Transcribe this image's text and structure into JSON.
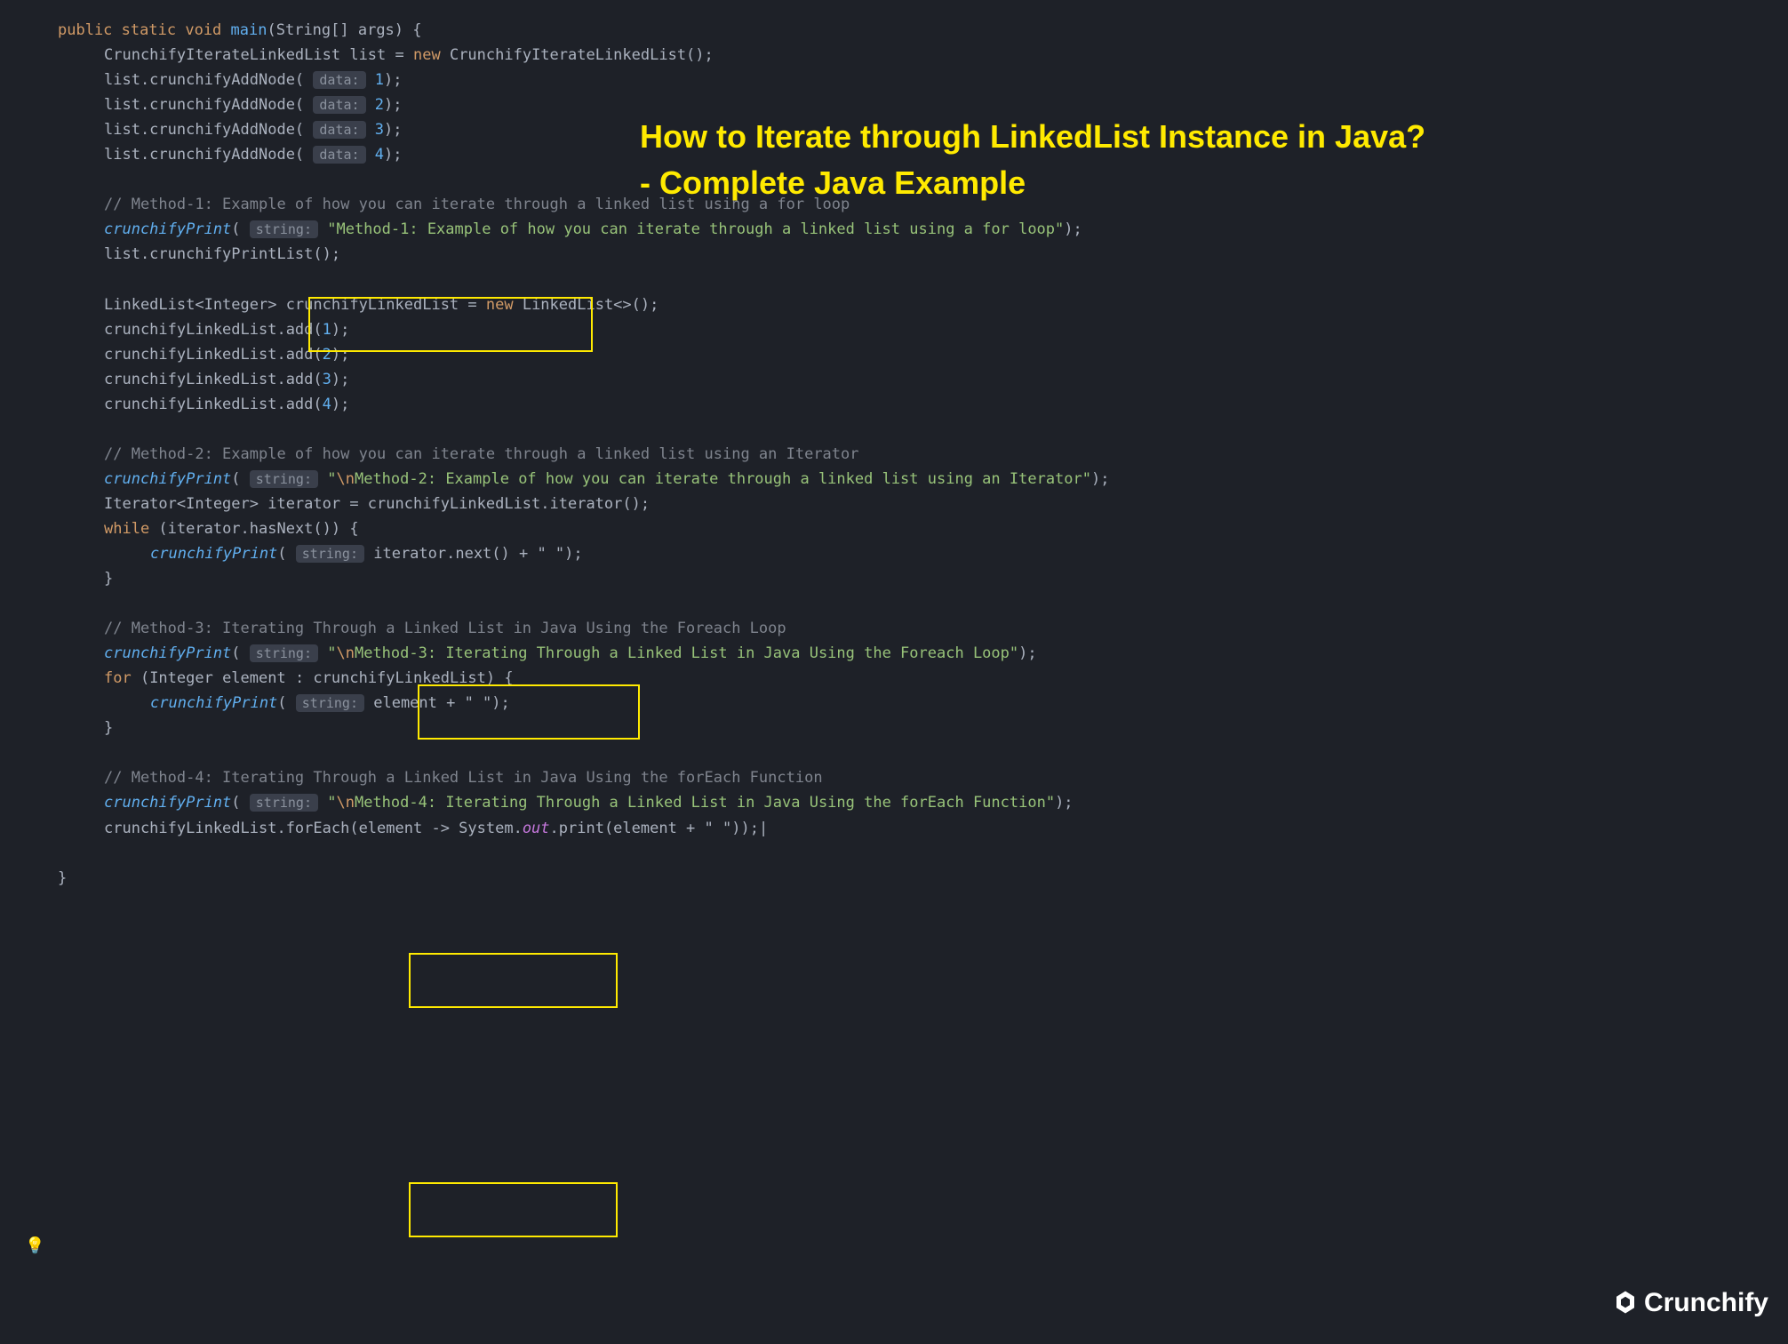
{
  "title_line1": "How to Iterate through LinkedList Instance in Java?",
  "title_line2": "- Complete Java Example",
  "logo_text": "Crunchify",
  "bulb": "💡",
  "kw": {
    "public": "public",
    "static": "static",
    "void": "void",
    "new": "new",
    "while": "while",
    "for": "for"
  },
  "sig": {
    "main": "main",
    "params": "(String[] args) {"
  },
  "hints": {
    "data": "data:",
    "string": "string:"
  },
  "lines": {
    "l1_a": "CrunchifyIterateLinkedList list = ",
    "l1_b": " CrunchifyIterateLinkedList();",
    "add_prefix": "list.crunchifyAddNode( ",
    "add_suffix": ");",
    "n1": " 1",
    "n2": " 2",
    "n3": " 3",
    "n4": " 4",
    "cmt1": "// Method-1: Example of how you can iterate through a linked list using a for loop",
    "cp": "crunchifyPrint",
    "cp_open": "( ",
    "str1": " \"Method-1: Example of how you can iterate through a linked list using a for loop\"",
    "close_p": ");",
    "printlist": "list.crunchifyPrintList();",
    "ll_decl_a": "LinkedList<Integer> crunchifyLinkedList = ",
    "ll_decl_b": " LinkedList<>();",
    "lladd_prefix": "crunchifyLinkedList.add(",
    "lladd_num1": "1",
    "lladd_num2": "2",
    "lladd_num3": "3",
    "lladd_num4": "4",
    "lladd_suffix": ");",
    "cmt2": "// Method-2: Example of how you can iterate through a linked list using an Iterator",
    "str2_a": " \"",
    "str2_esc": "\\n",
    "str2_b": "Method-2: Example of how you can iterate through a linked list using an Iterator\"",
    "iter_decl": "Iterator<Integer> iterator = crunchifyLinkedList.iterator();",
    "while_cond": " (iterator.hasNext()) {",
    "iter_next": " iterator.next() + \" \"",
    "close_brace": "}",
    "cmt3": "// Method-3: Iterating Through a Linked List in Java Using the Foreach Loop",
    "str3_b": "Method-3: Iterating Through a Linked List in Java Using the Foreach Loop\"",
    "for_head": " (Integer element : crunchifyLinkedList) {",
    "elem_cat": " element + \" \"",
    "cmt4": "// Method-4: Iterating Through a Linked List in Java Using the forEach Function",
    "str4_b": "Method-4: Iterating Through a Linked List in Java Using the forEach Function\"",
    "foreach_a": "crunchifyLinkedList.forEach(element -> System.",
    "foreach_out": "out",
    "foreach_b": ".print(element + \" \"));",
    "caret": "|"
  }
}
